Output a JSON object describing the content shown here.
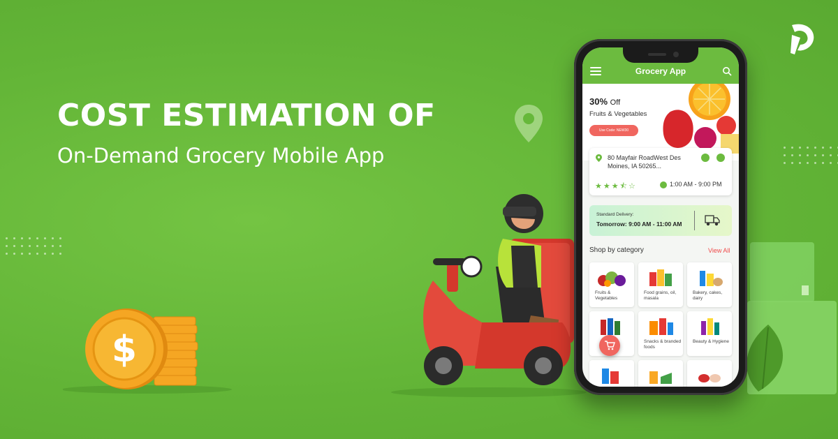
{
  "banner": {
    "headline": "COST ESTIMATION OF",
    "subline": "On-Demand Grocery Mobile App"
  },
  "colors": {
    "background": "#66b83a",
    "accent_green": "#6cbb3f",
    "accent_red": "#f0665f",
    "coin_gold": "#f5a623"
  },
  "icons": [
    "brand-logo-icon",
    "location-pin-icon",
    "dollar-coin-icon",
    "menu-icon",
    "search-icon",
    "phone-call-icon",
    "navigation-icon",
    "clock-icon",
    "truck-icon",
    "cart-icon"
  ],
  "app": {
    "title": "Grocery App",
    "promo": {
      "discount": "30%",
      "discount_unit": "Off",
      "subtitle": "Fruits & Vegetables",
      "code": "Use Code: NEW30"
    },
    "store": {
      "address": "80 Mayfair RoadWest Des Moines, IA 50265...",
      "rating_stars": "★★★⯪☆",
      "rating": 3.5,
      "hours": "1:00 AM - 9:00 PM"
    },
    "delivery": {
      "label": "Standard Delivery:",
      "time": "Tomorrow: 9:00 AM - 11:00 AM"
    },
    "shop_heading": "Shop by category",
    "view_all": "View All",
    "categories": [
      {
        "label": "Fruits & Vegetables"
      },
      {
        "label": "Food grains, oil, masala"
      },
      {
        "label": "Bakery, cakes, dairy"
      },
      {
        "label": ""
      },
      {
        "label": "Snacks & branded foods"
      },
      {
        "label": "Beauty & Hygiene"
      },
      {
        "label": ""
      },
      {
        "label": ""
      },
      {
        "label": ""
      }
    ]
  }
}
